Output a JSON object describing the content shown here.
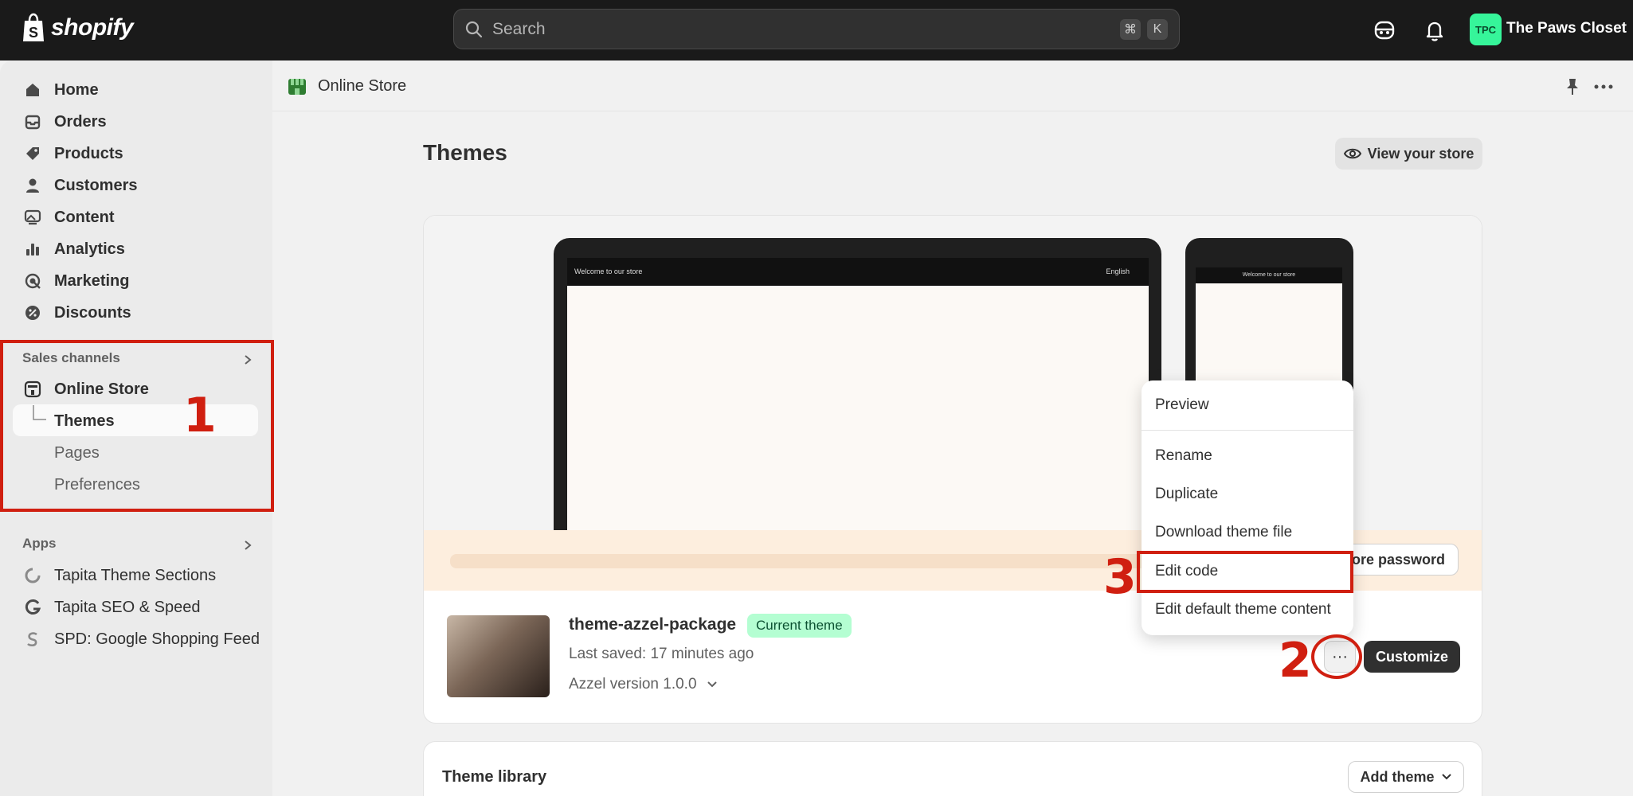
{
  "topbar": {
    "brand": "shopify",
    "search_placeholder": "Search",
    "shortcut_keys": [
      "⌘",
      "K"
    ],
    "store_initials": "TPC",
    "store_name": "The Paws Closet"
  },
  "sidebar": {
    "items": [
      {
        "label": "Home",
        "icon": "home-icon"
      },
      {
        "label": "Orders",
        "icon": "inbox-icon"
      },
      {
        "label": "Products",
        "icon": "tag-icon"
      },
      {
        "label": "Customers",
        "icon": "person-icon"
      },
      {
        "label": "Content",
        "icon": "image-icon"
      },
      {
        "label": "Analytics",
        "icon": "bar-chart-icon"
      },
      {
        "label": "Marketing",
        "icon": "target-icon"
      },
      {
        "label": "Discounts",
        "icon": "discount-icon"
      }
    ],
    "sales_channels": {
      "heading": "Sales channels",
      "channel": "Online Store",
      "sub_items": [
        "Themes",
        "Pages",
        "Preferences"
      ]
    },
    "apps": {
      "heading": "Apps",
      "items": [
        "Tapita Theme Sections",
        "Tapita SEO & Speed",
        "SPD: Google Shopping Feed"
      ]
    }
  },
  "annotations": {
    "step1": "1",
    "step2": "2",
    "step3": "3",
    "accent": "#d01f10"
  },
  "main": {
    "breadcrumb": "Online Store",
    "title": "Themes",
    "view_store": "View your store",
    "preview": {
      "laptop_bar_left": "Welcome to our store",
      "laptop_bar_right": "English",
      "phone_bar": "Welcome to our store"
    },
    "store_password_button": "tore password",
    "theme": {
      "name": "theme-azzel-package",
      "badge": "Current theme",
      "last_saved": "Last saved: 17 minutes ago",
      "version": "Azzel version 1.0.0",
      "more_button": "···",
      "customize_button": "Customize"
    },
    "library": {
      "title": "Theme library",
      "add_theme": "Add theme"
    }
  },
  "menu": {
    "items": [
      "Preview",
      "Rename",
      "Duplicate",
      "Download theme file",
      "Edit code",
      "Edit default theme content"
    ]
  }
}
